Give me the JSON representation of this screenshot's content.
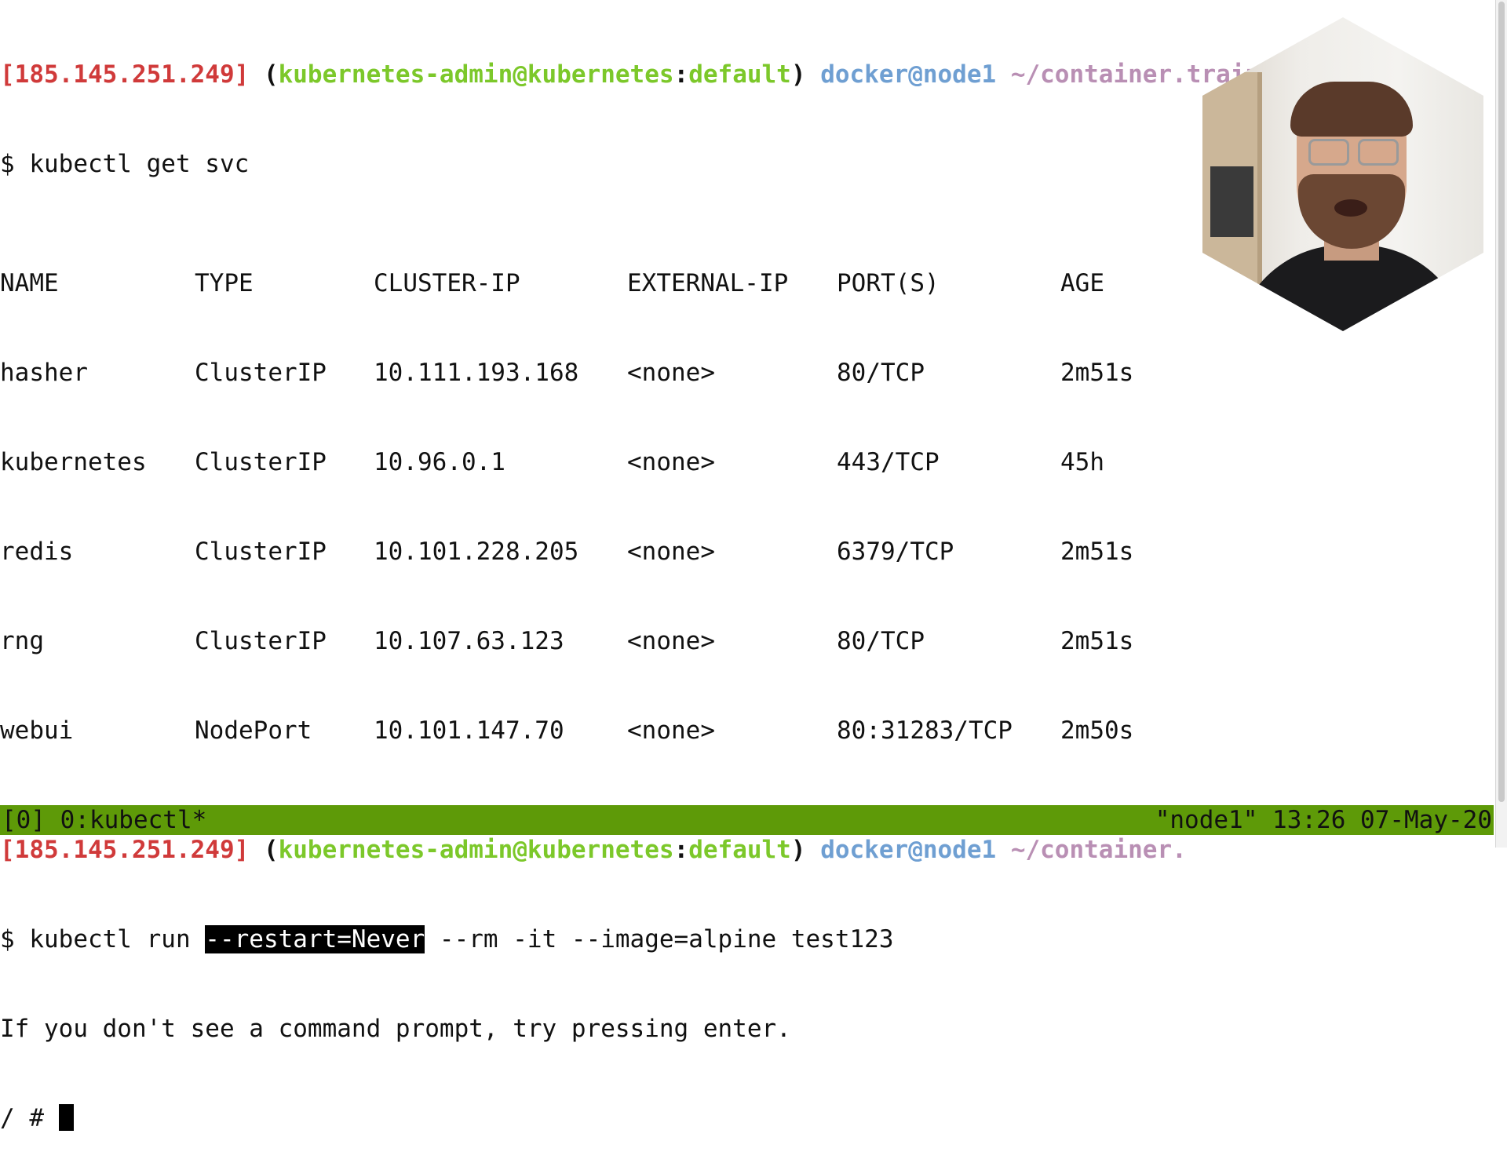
{
  "prompt": {
    "ip": "[185.145.251.249]",
    "open_paren": " (",
    "k8s_user": "kubernetes-admin@kubernetes",
    "colon": ":",
    "namespace": "default",
    "close_paren": ") ",
    "user_host": "docker@node1",
    "path": " ~/container.training/k8s",
    "path_truncated": " ~/container."
  },
  "commands": {
    "get_svc": "$ kubectl get svc",
    "run_prefix": "$ kubectl run ",
    "run_selected": "--restart=Never",
    "run_suffix": " --rm -it --image=alpine test123"
  },
  "table": {
    "headers": [
      "NAME",
      "TYPE",
      "CLUSTER-IP",
      "EXTERNAL-IP",
      "PORT(S)",
      "AGE"
    ],
    "rows": [
      [
        "hasher",
        "ClusterIP",
        "10.111.193.168",
        "<none>",
        "80/TCP",
        "2m51s"
      ],
      [
        "kubernetes",
        "ClusterIP",
        "10.96.0.1",
        "<none>",
        "443/TCP",
        "45h"
      ],
      [
        "redis",
        "ClusterIP",
        "10.101.228.205",
        "<none>",
        "6379/TCP",
        "2m51s"
      ],
      [
        "rng",
        "ClusterIP",
        "10.107.63.123",
        "<none>",
        "80/TCP",
        "2m51s"
      ],
      [
        "webui",
        "NodePort",
        "10.101.147.70",
        "<none>",
        "80:31283/TCP",
        "2m50s"
      ]
    ]
  },
  "output": {
    "hint": "If you don't see a command prompt, try pressing enter.",
    "shell_prompt": "/ # "
  },
  "statusbar": {
    "left": "[0] 0:kubectl*",
    "right": "\"node1\" 13:26 07-May-20"
  },
  "colors": {
    "ip": "#d03a3a",
    "context": "#7cc82a",
    "user_host": "#6f9fd2",
    "path": "#b98fb4",
    "statusbar_bg": "#5e9a08"
  },
  "icons": {
    "webcam": "presenter-webcam-overlay",
    "cursor": "text-cursor-block"
  }
}
